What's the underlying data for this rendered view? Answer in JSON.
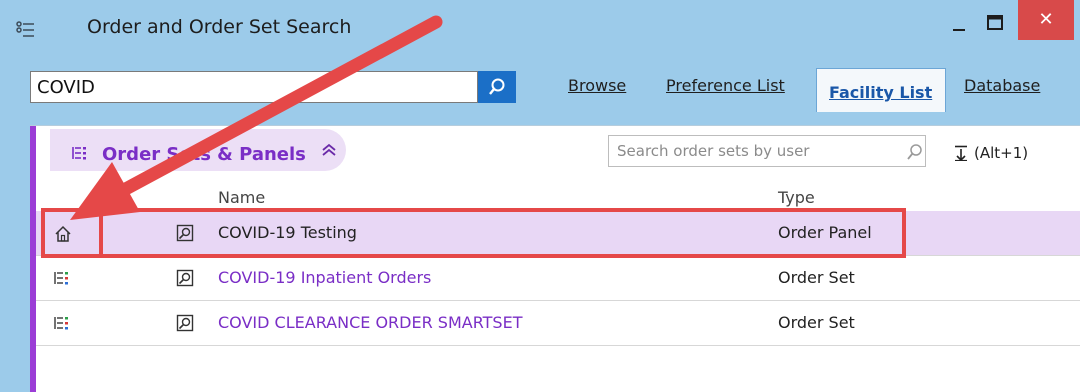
{
  "window": {
    "title": "Order and Order Set Search",
    "close_glyph": "✕"
  },
  "search": {
    "value": "COVID"
  },
  "tabs": [
    {
      "label": "Browse"
    },
    {
      "label": "Preference List"
    },
    {
      "label": "Facility List",
      "active": true
    },
    {
      "label": "Database"
    }
  ],
  "section": {
    "title": "Order Sets & Panels",
    "collapse_glyph": "≪",
    "user_search_placeholder": "Search order sets by user",
    "shortcut_label": "(Alt+1)"
  },
  "columns": {
    "name": "Name",
    "type": "Type"
  },
  "rows": [
    {
      "icon": "home-icon",
      "name": "COVID-19 Testing",
      "type": "Order Panel",
      "selected": true
    },
    {
      "icon": "order-set-icon",
      "name": "COVID-19 Inpatient Orders",
      "type": "Order Set"
    },
    {
      "icon": "order-set-icon",
      "name": "COVID CLEARANCE ORDER SMARTSET",
      "type": "Order Set"
    }
  ],
  "colors": {
    "accent": "#9b3dd6",
    "title_bar": "#9ccbea",
    "selected_row": "#e8d7f5",
    "annotation": "#e54848",
    "search_button": "#1b6fc7"
  }
}
